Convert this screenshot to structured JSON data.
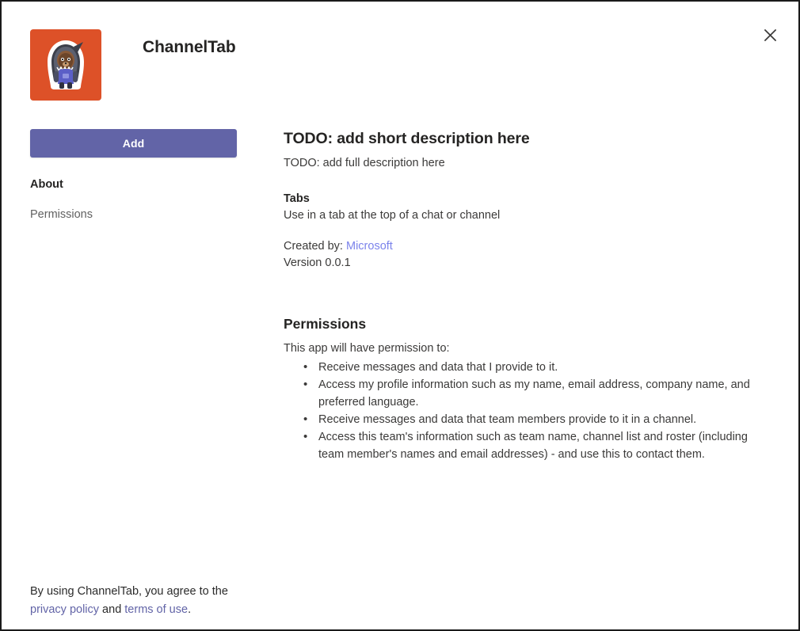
{
  "window": {
    "close_label": "✕",
    "close_icon": "close-icon"
  },
  "header": {
    "app_name": "ChannelTab",
    "icon": {
      "name": "channeltab-app-icon",
      "background_color": "#DD5128",
      "description": "mascot sticker character wearing a hooded shark costume with a purple shirt"
    }
  },
  "sidebar": {
    "add_button_label": "Add",
    "add_button_color": "#6264A7",
    "items": [
      {
        "label": "About",
        "selected": true
      },
      {
        "label": "Permissions",
        "selected": false
      }
    ]
  },
  "main": {
    "short_description": "TODO: add short description here",
    "full_description": "TODO: add full description here",
    "capability": {
      "heading": "Tabs",
      "description": "Use in a tab at the top of a chat or channel"
    },
    "meta": {
      "created_by_label": "Created by:",
      "created_by_value": "Microsoft",
      "version": "Version 0.0.1",
      "link_color": "#7B83EB"
    },
    "permissions": {
      "heading": "Permissions",
      "intro": "This app will have permission to:",
      "items": [
        "Receive messages and data that I provide to it.",
        "Access my profile information such as my name, email address, company name, and preferred language.",
        "Receive messages and data that team members provide to it in a channel.",
        "Access this team's information such as team name, channel list and roster (including team member's names and email addresses) - and use this to contact them."
      ]
    }
  },
  "footer": {
    "prefix": "By using ChannelTab, you agree to the ",
    "privacy_policy_label": "privacy policy",
    "middle": " and ",
    "terms_label": "terms of use",
    "suffix": ".",
    "link_color": "#6264A7"
  }
}
